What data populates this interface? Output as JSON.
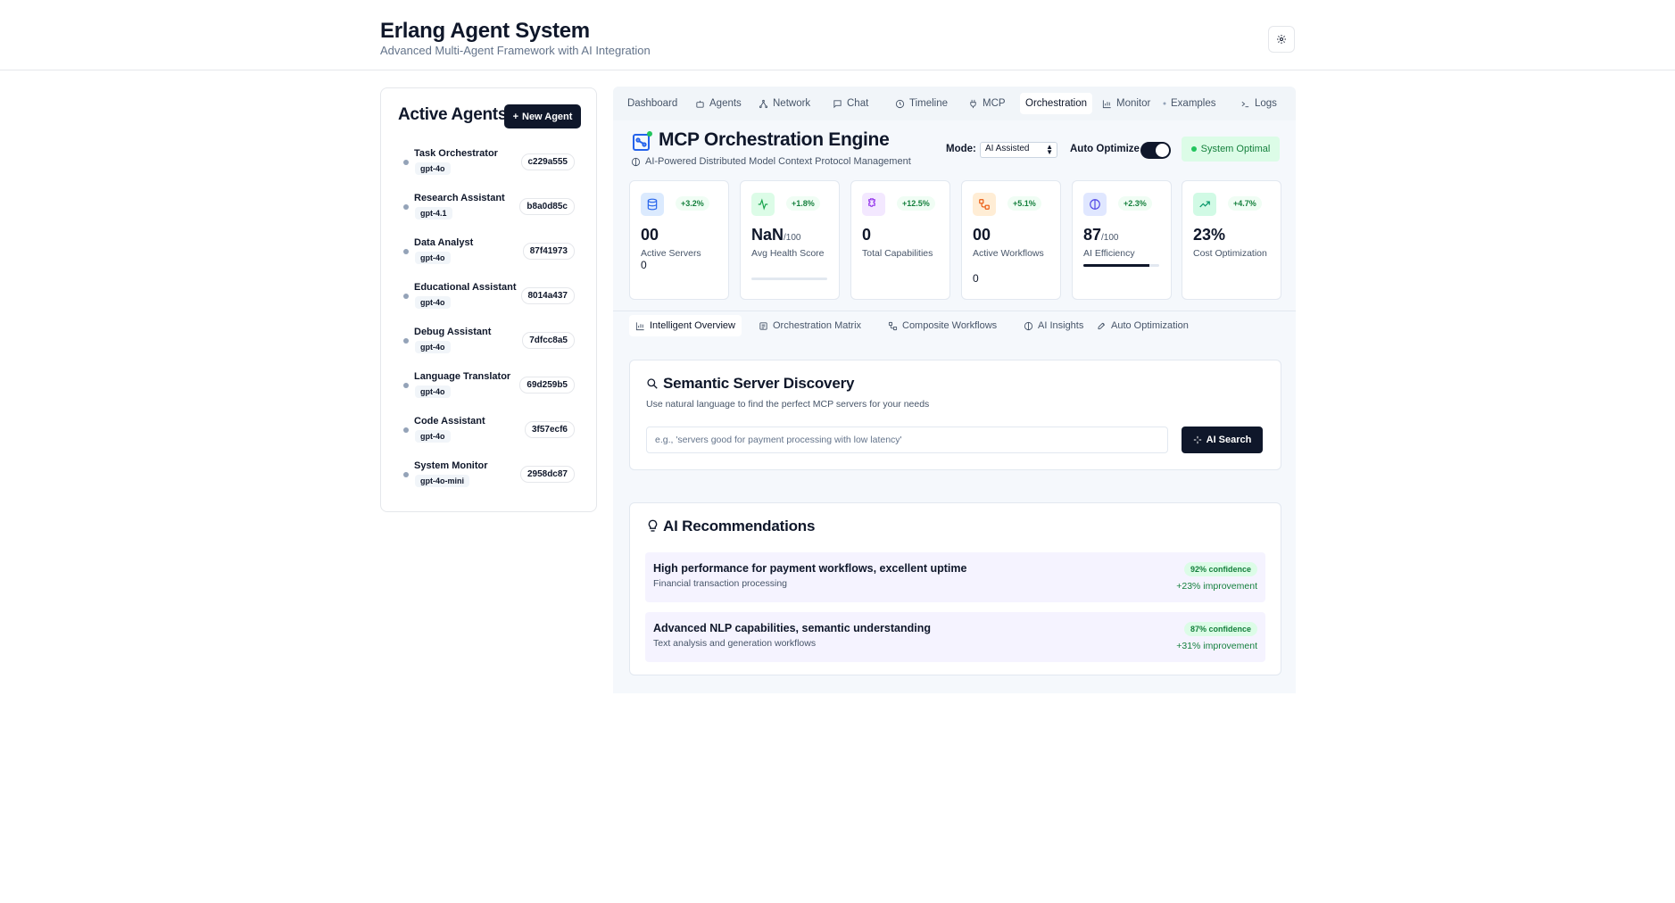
{
  "header": {
    "title": "Erlang Agent System",
    "subtitle": "Advanced Multi-Agent Framework with AI Integration"
  },
  "sidebar": {
    "title": "Active Agents",
    "new_agent_label": "New Agent",
    "agents": [
      {
        "name": "Task Orchestrator",
        "model": "gpt-4o",
        "id": "c229a555"
      },
      {
        "name": "Research Assistant",
        "model": "gpt-4.1",
        "id": "b8a0d85c"
      },
      {
        "name": "Data Analyst",
        "model": "gpt-4o",
        "id": "87f41973"
      },
      {
        "name": "Educational Assistant",
        "model": "gpt-4o",
        "id": "8014a437"
      },
      {
        "name": "Debug Assistant",
        "model": "gpt-4o",
        "id": "7dfcc8a5"
      },
      {
        "name": "Language Translator",
        "model": "gpt-4o",
        "id": "69d259b5"
      },
      {
        "name": "Code Assistant",
        "model": "gpt-4o",
        "id": "3f57ecf6"
      },
      {
        "name": "System Monitor",
        "model": "gpt-4o-mini",
        "id": "2958dc87"
      }
    ]
  },
  "nav": {
    "tabs": [
      {
        "label": "Dashboard",
        "icon": "none"
      },
      {
        "label": "Agents",
        "icon": "bot-icon"
      },
      {
        "label": "Network",
        "icon": "network-icon"
      },
      {
        "label": "Chat",
        "icon": "chat-icon"
      },
      {
        "label": "Timeline",
        "icon": "clock-icon"
      },
      {
        "label": "MCP",
        "icon": "plug-icon"
      },
      {
        "label": "Orchestration",
        "icon": "none"
      },
      {
        "label": "Monitor",
        "icon": "bar-chart-icon"
      },
      {
        "label": "Examples",
        "icon": "dot-icon"
      },
      {
        "label": "Logs",
        "icon": "terminal-icon"
      }
    ],
    "active": "Orchestration"
  },
  "engine": {
    "title": "MCP Orchestration Engine",
    "subtitle": "AI-Powered Distributed Model Context Protocol Management",
    "mode_label": "Mode:",
    "mode_value": "AI Assisted",
    "auto_optimize_label": "Auto Optimize",
    "auto_optimize_on": true,
    "status_badge": "System Optimal"
  },
  "stats": [
    {
      "icon": "database-icon",
      "delta": "+3.2%",
      "value": "00",
      "suffix": "",
      "label": "Active Servers",
      "extra": "0",
      "accent": "#dbeafe",
      "iconColor": "#2563eb"
    },
    {
      "icon": "activity-icon",
      "delta": "+1.8%",
      "value": "NaN",
      "suffix": "/100",
      "label": "Avg Health Score",
      "extra": "",
      "progress": 0,
      "accent": "#dcfce7",
      "iconColor": "#16a34a"
    },
    {
      "icon": "puzzle-icon",
      "delta": "+12.5%",
      "value": "0",
      "suffix": "",
      "label": "Total Capabilities",
      "extra": "",
      "accent": "#f3e8ff",
      "iconColor": "#9333ea"
    },
    {
      "icon": "workflow-icon",
      "delta": "+5.1%",
      "value": "00",
      "suffix": "",
      "label": "Active Workflows",
      "extra": "0",
      "accent": "#ffedd5",
      "iconColor": "#ea580c"
    },
    {
      "icon": "brain-icon",
      "delta": "+2.3%",
      "value": "87",
      "suffix": "/100",
      "label": "AI Efficiency",
      "extra": "",
      "progress": 0.87,
      "accent": "#e0e7ff",
      "iconColor": "#4f46e5"
    },
    {
      "icon": "trending-up-icon",
      "delta": "+4.7%",
      "value": "23%",
      "suffix": "",
      "label": "Cost Optimization",
      "extra": "",
      "accent": "#d1fae5",
      "iconColor": "#059669"
    }
  ],
  "sub_tabs": [
    {
      "label": "Intelligent Overview",
      "icon": "bar-chart-icon"
    },
    {
      "label": "Orchestration Matrix",
      "icon": "grid-icon"
    },
    {
      "label": "Composite Workflows",
      "icon": "workflow-icon"
    },
    {
      "label": "AI Insights",
      "icon": "brain-icon"
    },
    {
      "label": "Auto Optimization",
      "icon": "rocket-icon"
    }
  ],
  "discovery": {
    "title": "Semantic Server Discovery",
    "description": "Use natural language to find the perfect MCP servers for your needs",
    "placeholder": "e.g., 'servers good for payment processing with low latency'",
    "button": "AI Search"
  },
  "recommendations": {
    "title": "AI Recommendations",
    "items": [
      {
        "title": "High performance for payment workflows, excellent uptime",
        "desc": "Financial transaction processing",
        "confidence": "92% confidence",
        "improvement": "+23% improvement"
      },
      {
        "title": "Advanced NLP capabilities, semantic understanding",
        "desc": "Text analysis and generation workflows",
        "confidence": "87% confidence",
        "improvement": "+31% improvement"
      }
    ]
  }
}
